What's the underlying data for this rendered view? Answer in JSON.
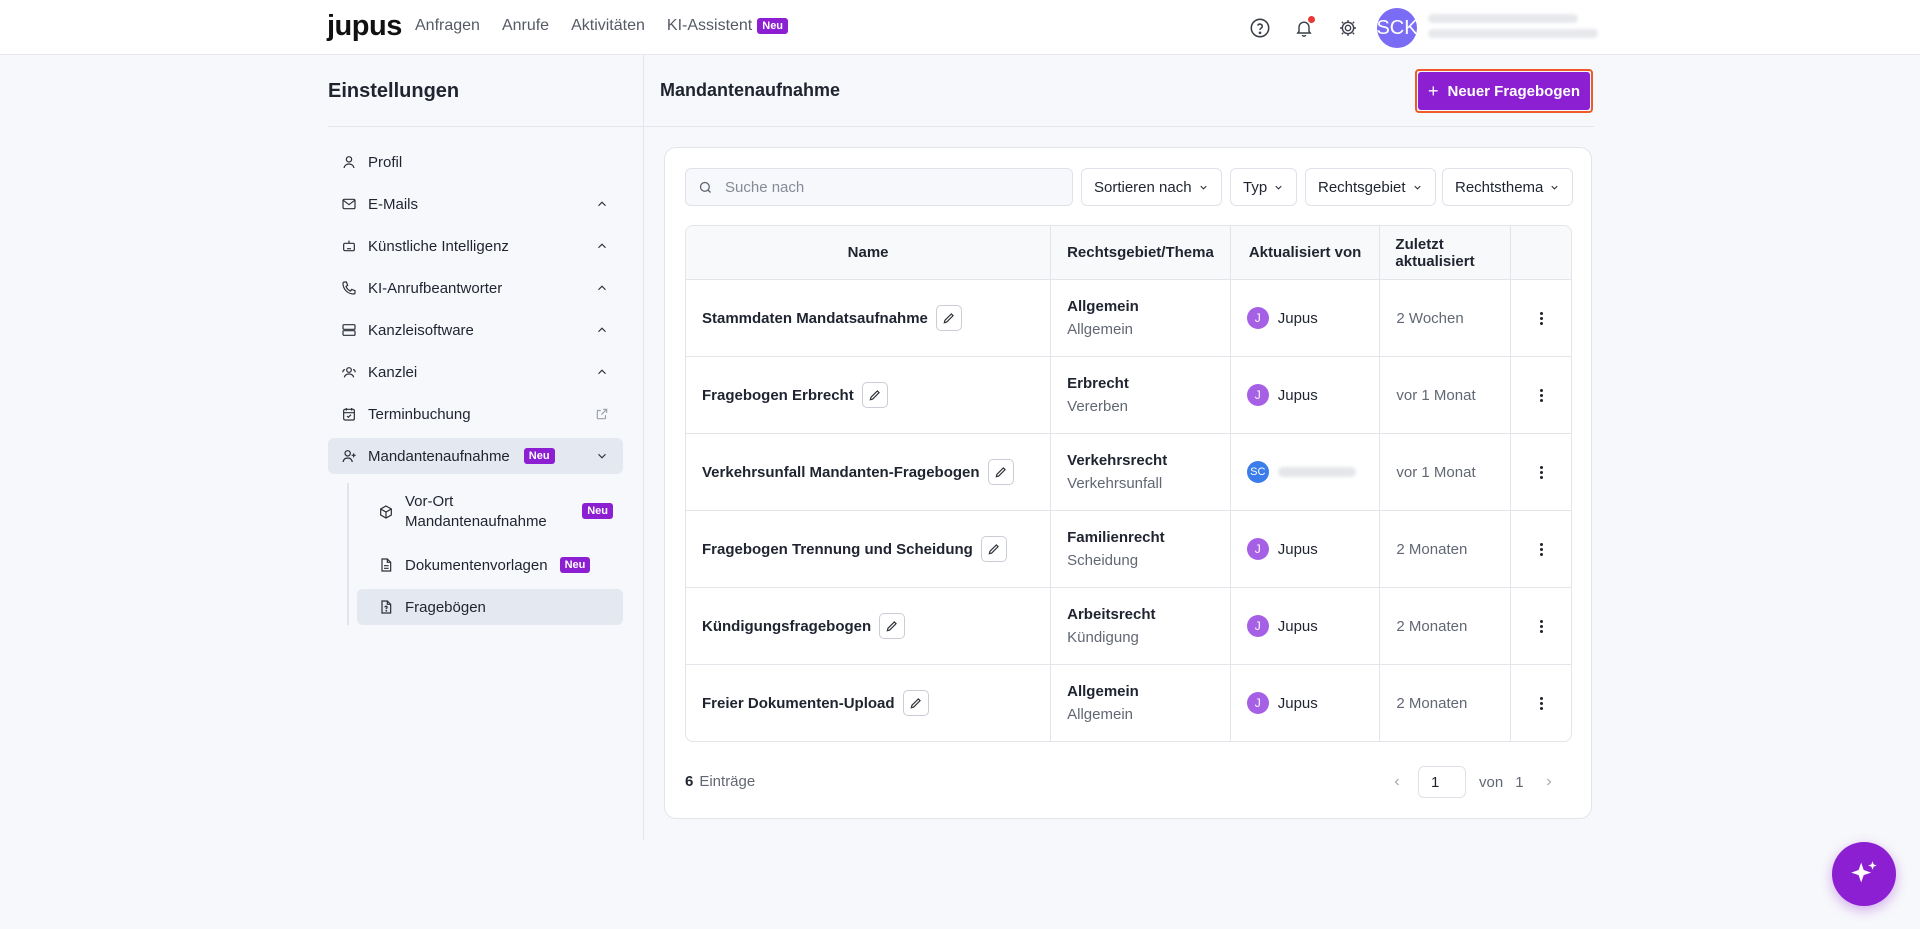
{
  "brand": {
    "logo": "jupus"
  },
  "nav": {
    "items": [
      {
        "label": "Anfragen"
      },
      {
        "label": "Anrufe"
      },
      {
        "label": "Aktivitäten"
      },
      {
        "label": "KI-Assistent",
        "badge": "Neu"
      }
    ]
  },
  "user": {
    "initials": "SCK"
  },
  "settings": {
    "title": "Einstellungen",
    "menu": [
      {
        "label": "Profil",
        "icon": "user-icon"
      },
      {
        "label": "E-Mails",
        "icon": "mail-icon"
      },
      {
        "label": "Künstliche Intelligenz",
        "icon": "robot-icon"
      },
      {
        "label": "KI-Anrufbeantworter",
        "icon": "phone-icon"
      },
      {
        "label": "Kanzleisoftware",
        "icon": "server-icon"
      },
      {
        "label": "Kanzlei",
        "icon": "team-icon"
      },
      {
        "label": "Terminbuchung",
        "icon": "calendar-icon"
      },
      {
        "label": "Mandantenaufnahme",
        "icon": "user-plus-icon",
        "badge": "Neu"
      }
    ],
    "submenu": [
      {
        "label": "Vor-Ort Mandantenaufnahme",
        "badge": "Neu",
        "icon": "cube-icon"
      },
      {
        "label": "Dokumentenvorlagen",
        "badge": "Neu",
        "icon": "document-icon"
      },
      {
        "label": "Fragebögen",
        "icon": "form-icon"
      }
    ]
  },
  "page": {
    "title": "Mandantenaufnahme",
    "new_button": "Neuer Fragebogen"
  },
  "toolbar": {
    "search_placeholder": "Suche nach",
    "sort_label": "Sortieren nach",
    "type_label": "Typ",
    "area_label": "Rechtsgebiet",
    "topic_label": "Rechtsthema"
  },
  "table": {
    "headers": [
      "Name",
      "Rechtsgebiet/Thema",
      "Aktualisiert von",
      "Zuletzt aktualisiert"
    ],
    "rows": [
      {
        "name": "Stammdaten Mandatsaufnahme",
        "area": "Allgemein",
        "topic": "Allgemein",
        "avatar": "J",
        "updater": "Jupus",
        "updated": "2 Wochen"
      },
      {
        "name": "Fragebogen Erbrecht",
        "area": "Erbrecht",
        "topic": "Vererben",
        "avatar": "J",
        "updater": "Jupus",
        "updated": "vor 1 Monat"
      },
      {
        "name": "Verkehrsunfall Mandanten-Fragebogen",
        "area": "Verkehrsrecht",
        "topic": "Verkehrsunfall",
        "avatar": "SC",
        "updater": "",
        "updated": "vor 1 Monat"
      },
      {
        "name": "Fragebogen Trennung und Scheidung",
        "area": "Familienrecht",
        "topic": "Scheidung",
        "avatar": "J",
        "updater": "Jupus",
        "updated": "2 Monaten"
      },
      {
        "name": "Kündigungsfragebogen",
        "area": "Arbeitsrecht",
        "topic": "Kündigung",
        "avatar": "J",
        "updater": "Jupus",
        "updated": "2 Monaten"
      },
      {
        "name": "Freier Dokumenten-Upload",
        "area": "Allgemein",
        "topic": "Allgemein",
        "avatar": "J",
        "updater": "Jupus",
        "updated": "2 Monaten"
      }
    ]
  },
  "footer": {
    "count": "6",
    "count_label": "Einträge",
    "page": "1",
    "of_label": "von",
    "total_pages": "1"
  },
  "colors": {
    "accent": "#8b1fd1",
    "highlight_border": "#f05a28",
    "active_bg": "#e4e8f0"
  }
}
